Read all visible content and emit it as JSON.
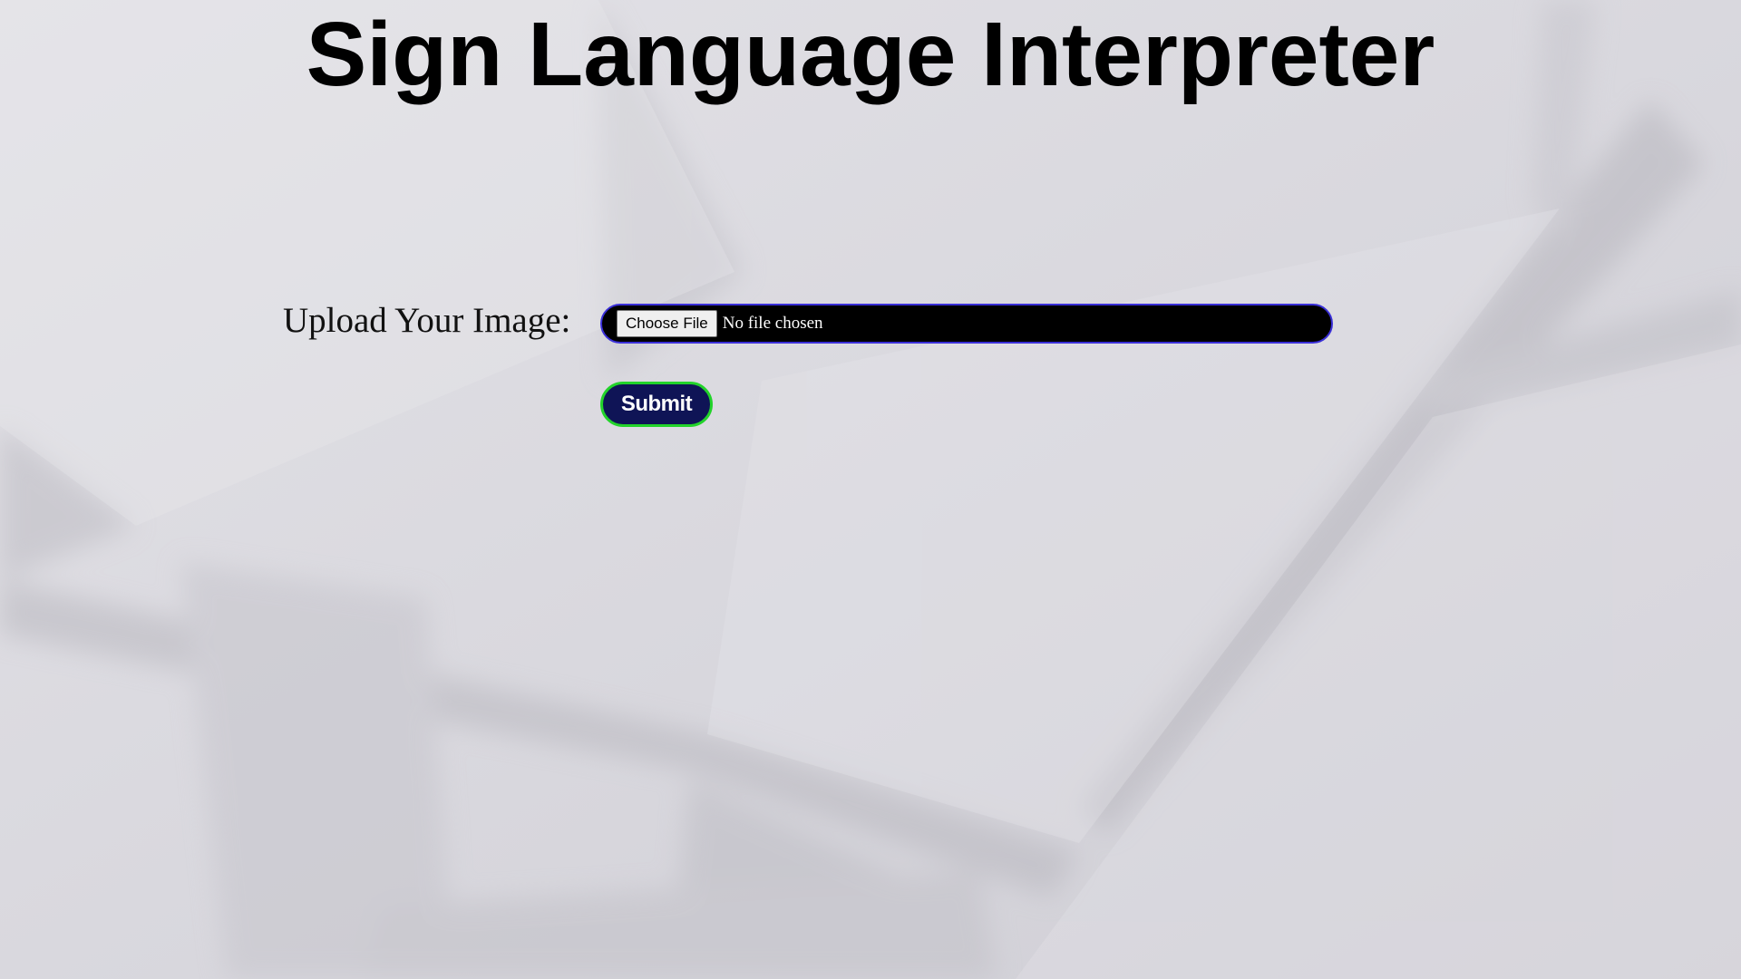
{
  "page": {
    "title": "Sign Language Interpreter",
    "background_color": "#dcdbe1"
  },
  "form": {
    "upload_label": "Upload Your Image:",
    "file_input": {
      "button_label": "Choose File",
      "status_text": "No file chosen",
      "background_color": "#000000",
      "border_color": "#3a2fd8"
    },
    "submit": {
      "label": "Submit",
      "background_color": "#0f1456",
      "border_color": "#22d32a"
    }
  }
}
